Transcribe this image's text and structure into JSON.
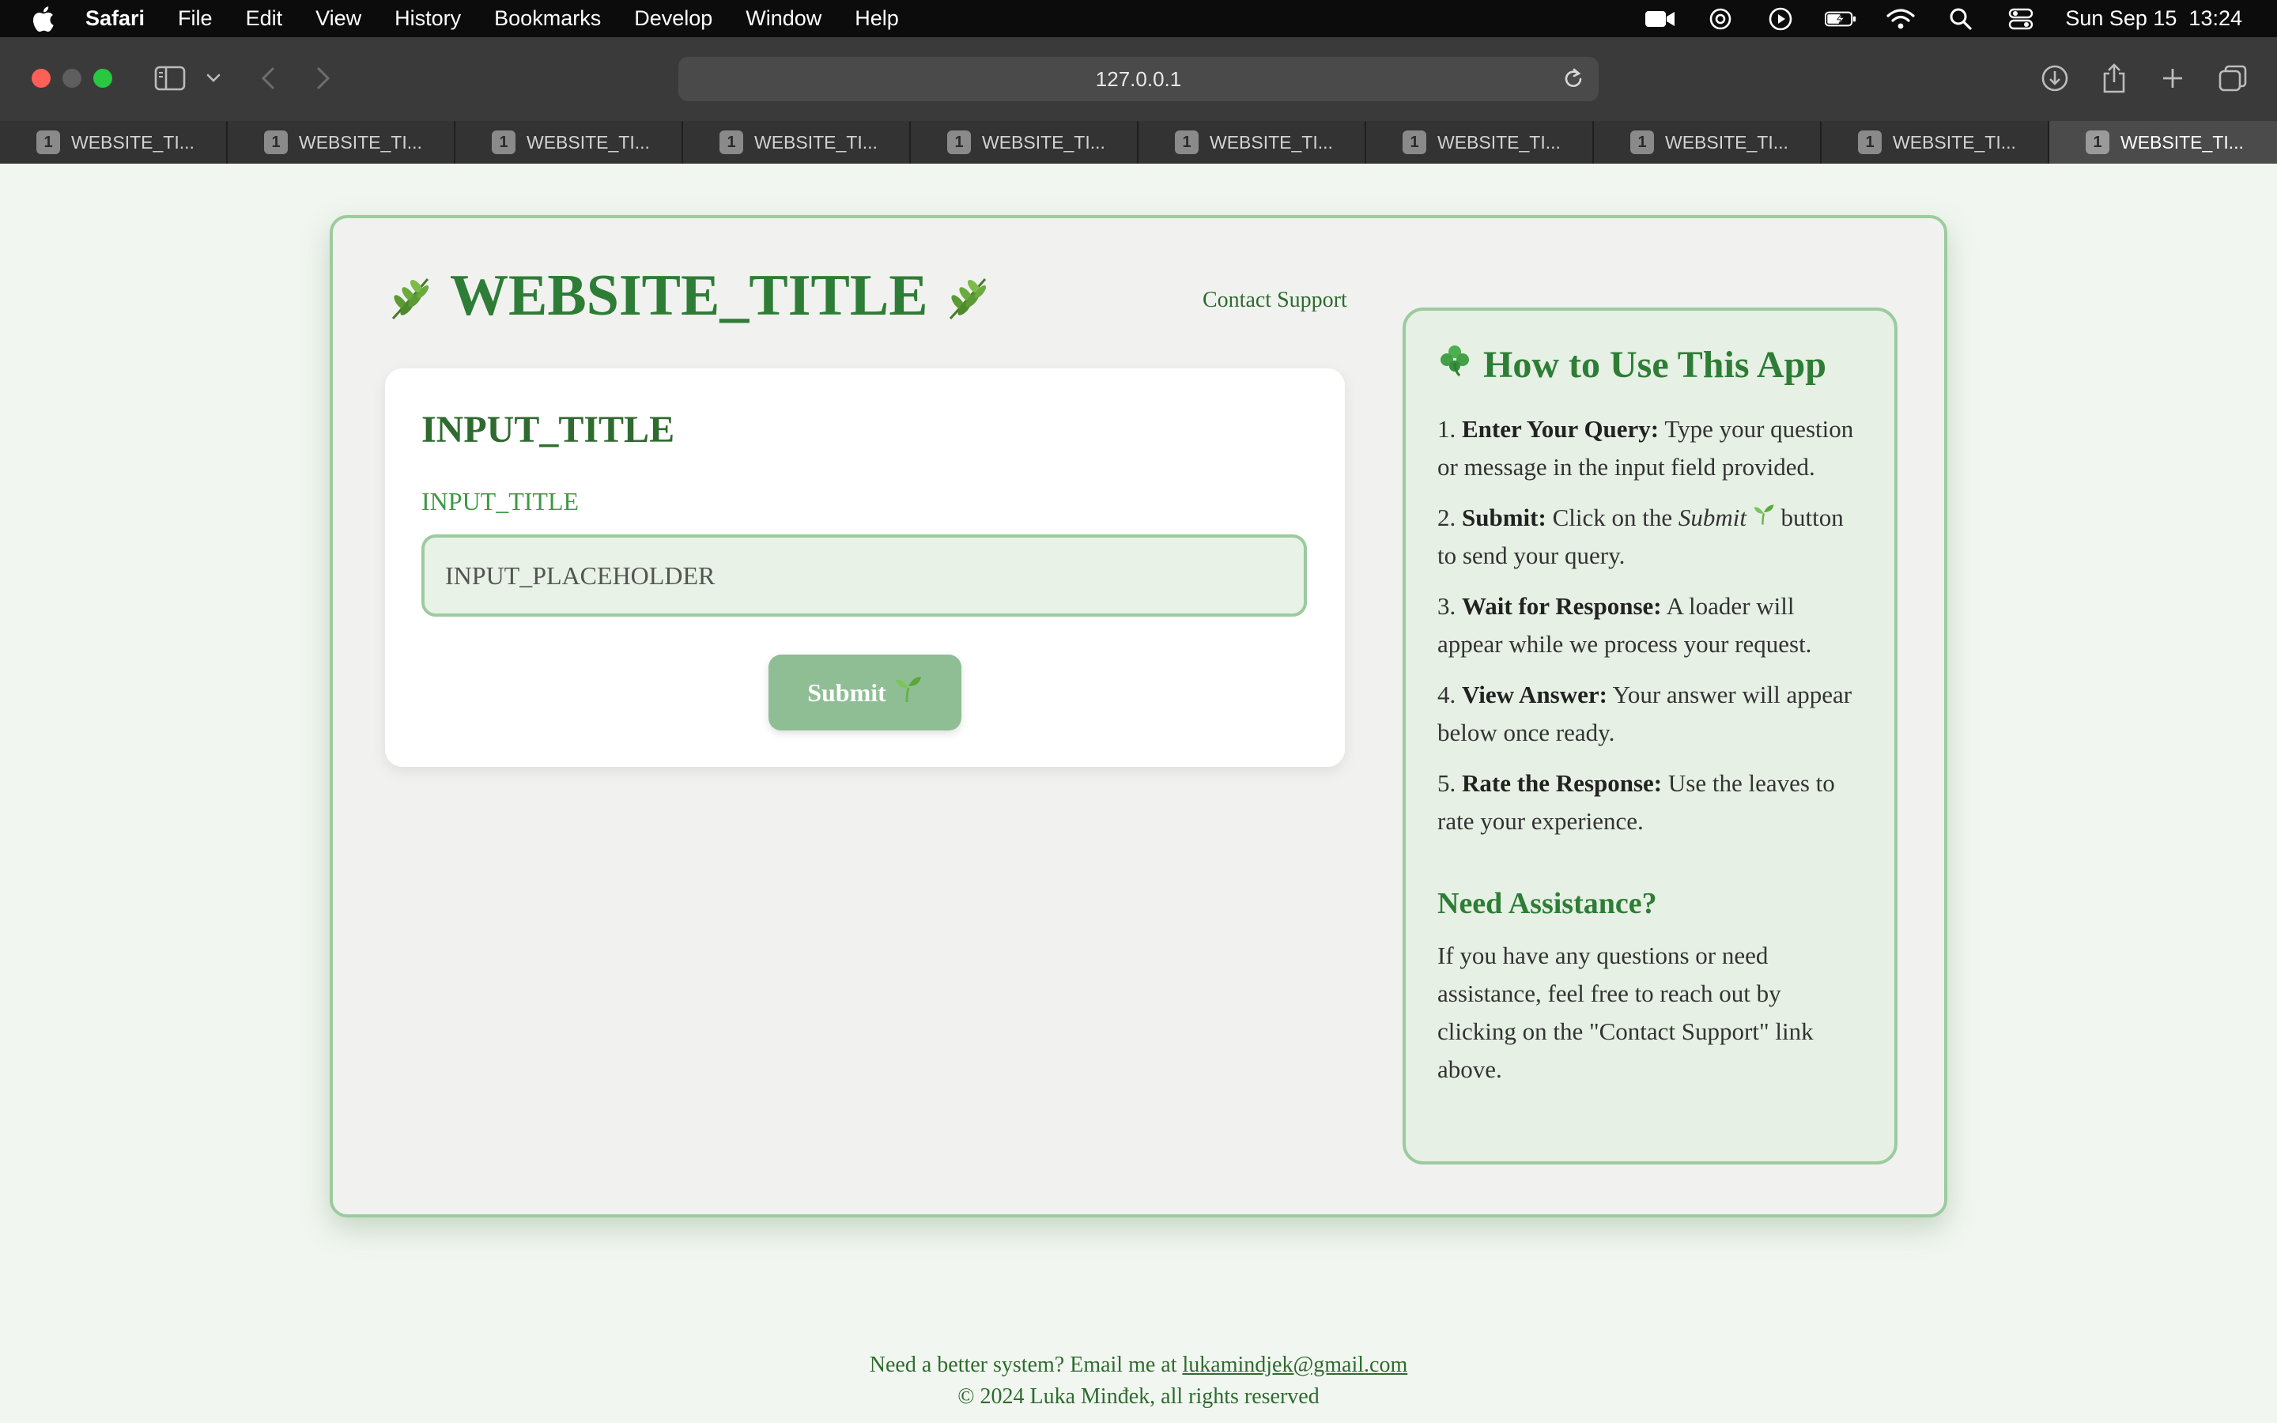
{
  "menubar": {
    "app_name": "Safari",
    "items": [
      "File",
      "Edit",
      "View",
      "History",
      "Bookmarks",
      "Develop",
      "Window",
      "Help"
    ],
    "clock": "Sun Sep 15  13:24"
  },
  "browser": {
    "url": "127.0.0.1",
    "tabs": [
      {
        "num": "1",
        "label": "WEBSITE_TI..."
      },
      {
        "num": "1",
        "label": "WEBSITE_TI..."
      },
      {
        "num": "1",
        "label": "WEBSITE_TI..."
      },
      {
        "num": "1",
        "label": "WEBSITE_TI..."
      },
      {
        "num": "1",
        "label": "WEBSITE_TI..."
      },
      {
        "num": "1",
        "label": "WEBSITE_TI..."
      },
      {
        "num": "1",
        "label": "WEBSITE_TI..."
      },
      {
        "num": "1",
        "label": "WEBSITE_TI..."
      },
      {
        "num": "1",
        "label": "WEBSITE_TI..."
      },
      {
        "num": "1",
        "label": "WEBSITE_TI..."
      }
    ]
  },
  "page": {
    "title": "WEBSITE_TITLE",
    "contact_link": "Contact Support",
    "input": {
      "title": "INPUT_TITLE",
      "label": "INPUT_TITLE",
      "placeholder": "INPUT_PLACEHOLDER",
      "submit_label": "Submit"
    },
    "howto": {
      "title": "How to Use This App",
      "steps": [
        {
          "num": "1.",
          "bold": "Enter Your Query:",
          "text": " Type your question or message in the input field provided."
        },
        {
          "num": "2.",
          "bold": "Submit:",
          "text_before": " Click on the ",
          "em": "Submit",
          "text": " button to send your query."
        },
        {
          "num": "3.",
          "bold": "Wait for Response:",
          "text": " A loader will appear while we process your request."
        },
        {
          "num": "4.",
          "bold": "View Answer:",
          "text": " Your answer will appear below once ready."
        },
        {
          "num": "5.",
          "bold": "Rate the Response:",
          "text": " Use the leaves to rate your experience."
        }
      ],
      "assist_title": "Need Assistance?",
      "assist_text": "If you have any questions or need assistance, feel free to reach out by clicking on the \"Contact Support\" link above."
    },
    "footer": {
      "line1_prefix": "Need a better system? Email me at ",
      "email": "lukamindjek@gmail.com",
      "line2": "© 2024 Luka Minđek, all rights reserved"
    }
  }
}
